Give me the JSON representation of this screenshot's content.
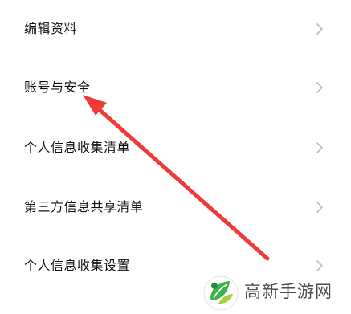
{
  "menu": {
    "items": [
      {
        "label": "编辑资料"
      },
      {
        "label": "账号与安全"
      },
      {
        "label": "个人信息收集清单"
      },
      {
        "label": "第三方信息共享清单"
      },
      {
        "label": "个人信息收集设置"
      }
    ]
  },
  "annotation": {
    "color": "#f03a3a"
  },
  "watermark": {
    "text": "高新手游网",
    "logo_colors": [
      "#3ab34a",
      "#a7d13e",
      "#1f8f3d"
    ]
  }
}
